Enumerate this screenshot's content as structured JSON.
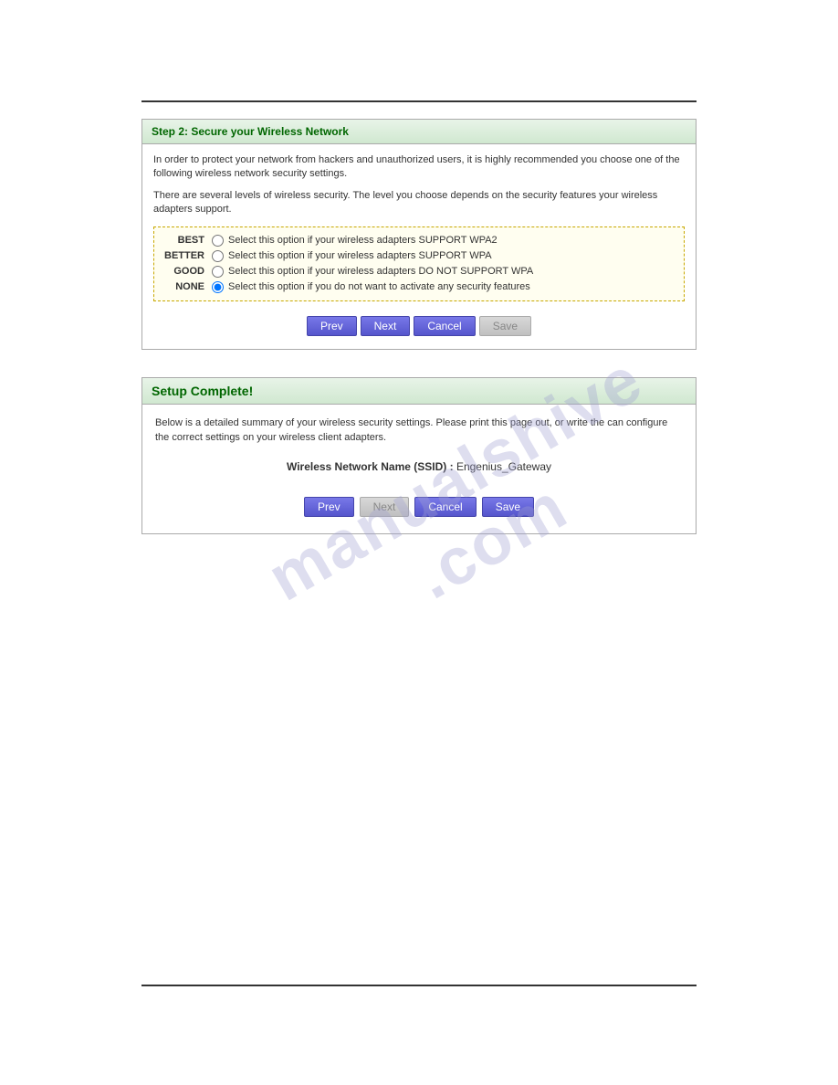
{
  "top_rule": {},
  "bottom_rule": {},
  "step2": {
    "header": "Step 2: Secure your Wireless Network",
    "intro": "In order to protect your network from hackers and unauthorized users, it is highly recommended you choose one of the following wireless network security settings.",
    "sublabel": "There are several levels of wireless security. The level you choose depends on the security features your wireless adapters support.",
    "security_options": [
      {
        "level": "BEST",
        "text": "Select this option if your wireless adapters SUPPORT WPA2",
        "checked": false
      },
      {
        "level": "BETTER",
        "text": "Select this option if your wireless adapters SUPPORT WPA",
        "checked": false
      },
      {
        "level": "GOOD",
        "text": "Select this option if your wireless adapters DO NOT SUPPORT WPA",
        "checked": false
      },
      {
        "level": "NONE",
        "text": "Select this option if you do not want to activate any security features",
        "checked": true
      }
    ],
    "buttons": {
      "prev": "Prev",
      "next": "Next",
      "cancel": "Cancel",
      "save": "Save"
    }
  },
  "setup": {
    "header": "Setup Complete!",
    "desc": "Below is a detailed summary of your wireless security settings. Please print this page out, or write the can configure the correct settings on your wireless client adapters.",
    "ssid_label": "Wireless Network Name (SSID) :",
    "ssid_value": "Engenius_Gateway",
    "buttons": {
      "prev": "Prev",
      "next": "Next",
      "cancel": "Cancel",
      "save": "Save"
    }
  },
  "watermark": {
    "line1": "manualshive",
    "line2": ".com"
  }
}
